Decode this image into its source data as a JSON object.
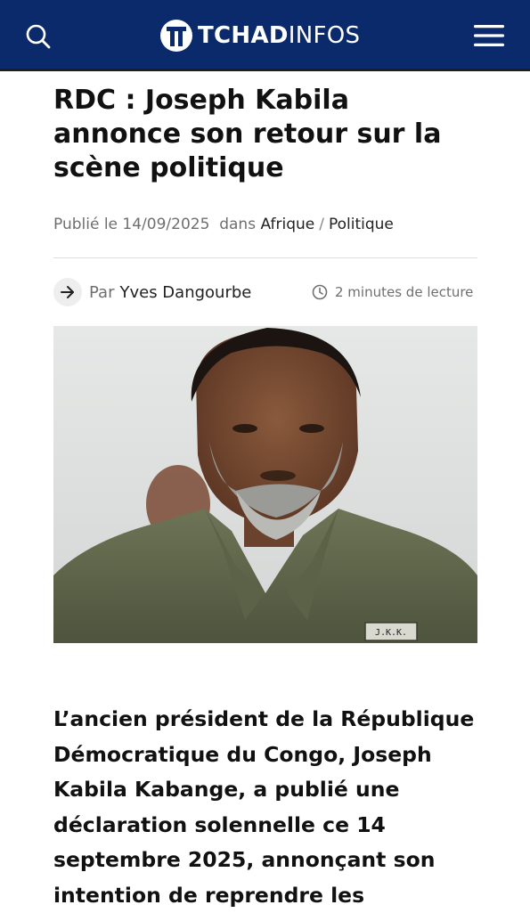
{
  "header": {
    "brand_bold": "TCHAD",
    "brand_light": "INFOS",
    "brand_color": "#0a2a6b",
    "icons": {
      "search": "search-icon",
      "menu": "hamburger-menu-icon"
    }
  },
  "article": {
    "title": "RDC : Joseph Kabila annonce son retour sur la scène politique",
    "published_prefix": "Publié le",
    "published_date": "14/09/2025",
    "in_label": "dans",
    "categories": [
      "Afrique",
      "Politique"
    ],
    "category_separator": "/",
    "by_label": "Par",
    "author": "Yves Dangourbe",
    "read_time": "2 minutes de lecture",
    "image_alt": "Joseph Kabila",
    "badge_text": "J.K.K.",
    "lead": "L’ancien président de la République Démocratique du Congo, Joseph Kabila Kabange, a publié une déclaration solennelle ce 14 septembre 2025, annonçant son intention de reprendre les"
  }
}
